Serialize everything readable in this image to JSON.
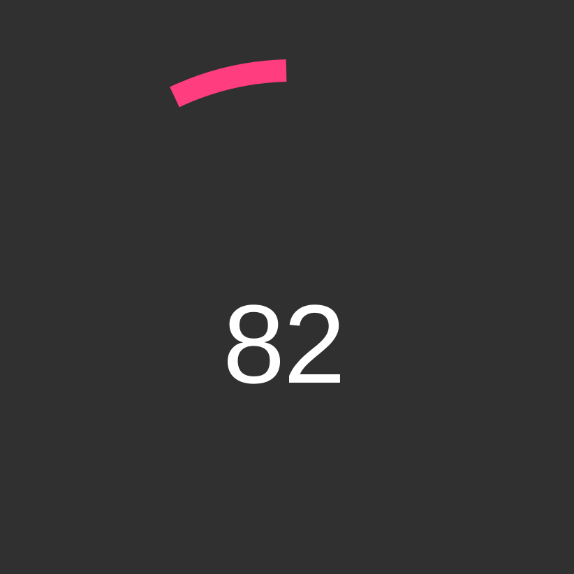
{
  "indicator": {
    "value": "82",
    "arc_color": "#ff3d7f",
    "text_color": "#ffffff",
    "background_color": "#303030"
  }
}
